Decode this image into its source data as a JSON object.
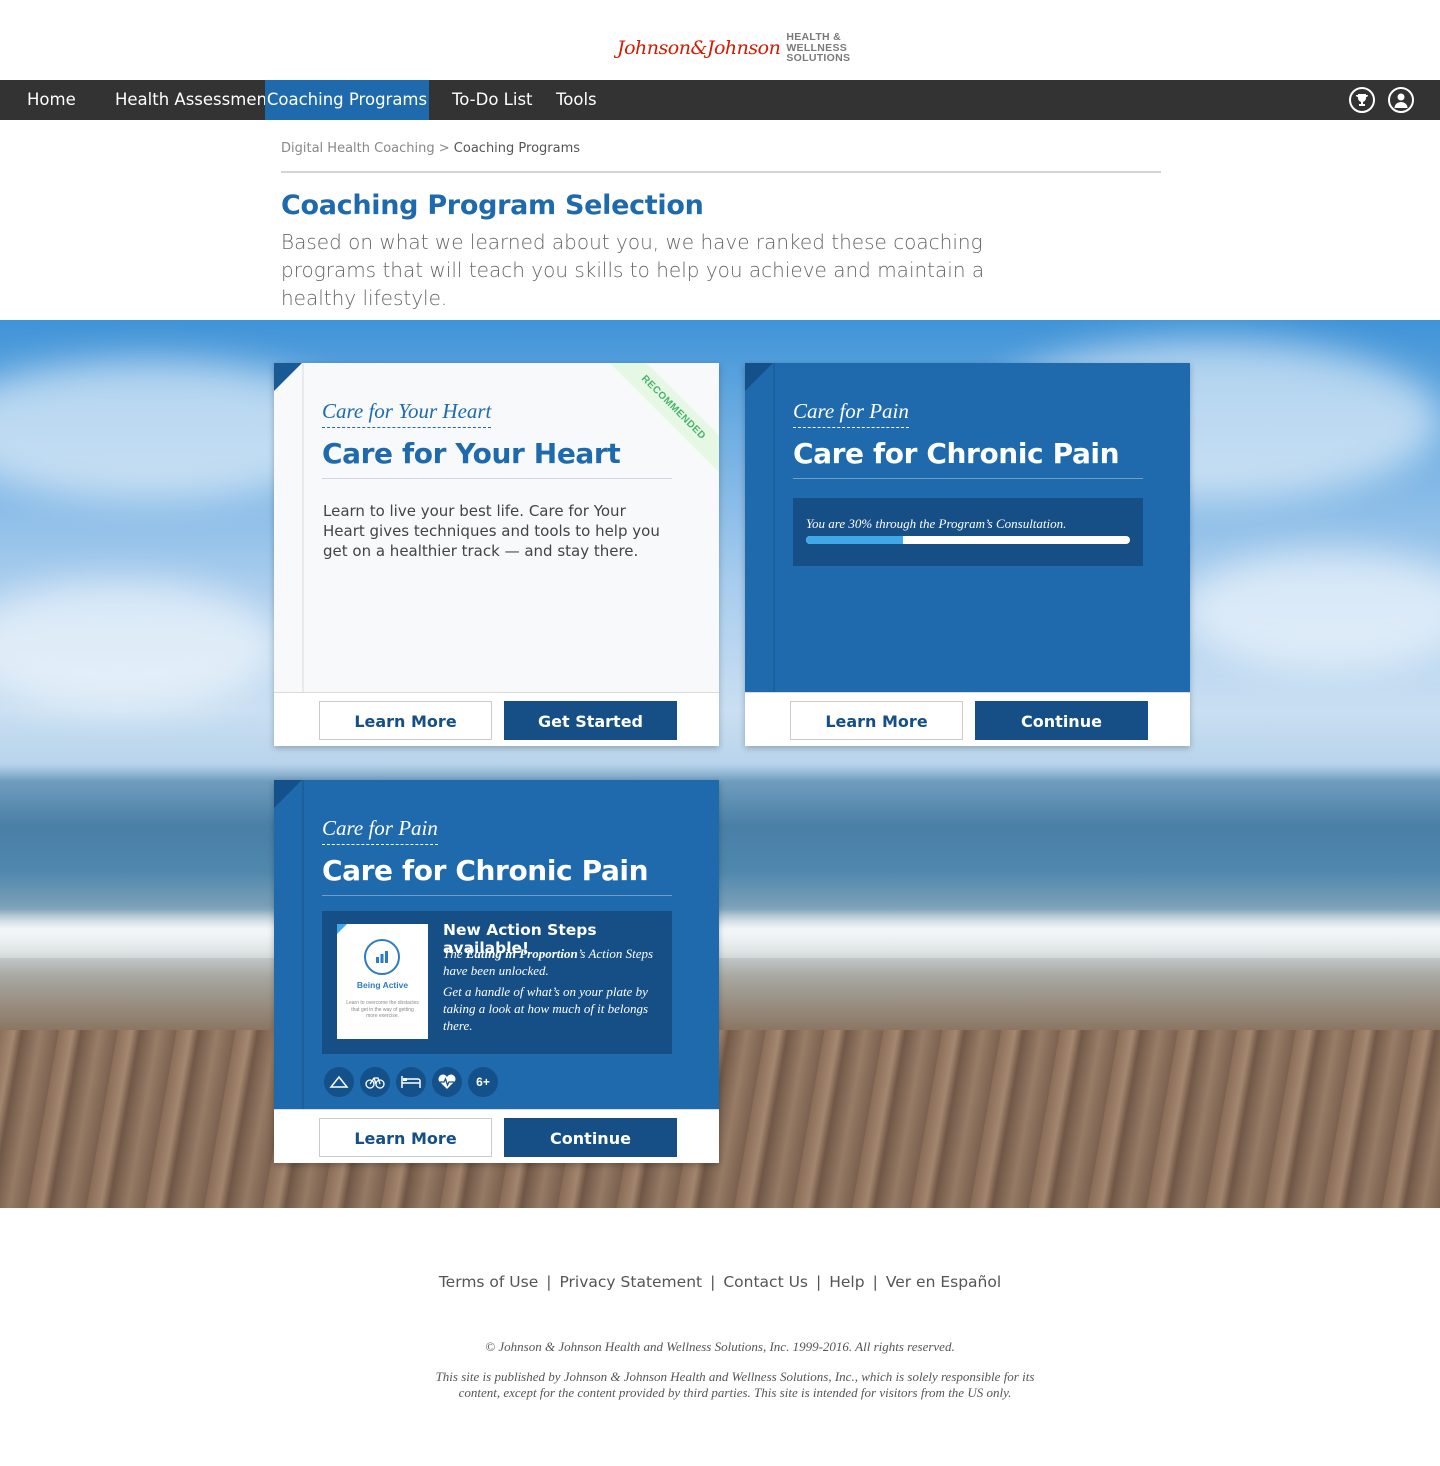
{
  "brand": {
    "logo_script": "Johnson&Johnson",
    "logo_lines": [
      "HEALTH &",
      "WELLNESS",
      "SOLUTIONS"
    ],
    "accent_color": "#1f6aad",
    "nav_color": "#333333",
    "button_color": "#154f86"
  },
  "nav": {
    "items": [
      {
        "label": "Home"
      },
      {
        "label": "Health Assessment"
      },
      {
        "label": "Coaching Programs",
        "active": true
      },
      {
        "label": "To-Do List"
      },
      {
        "label": "Tools"
      }
    ],
    "icons": [
      "trophy-icon",
      "user-profile-icon"
    ]
  },
  "breadcrumb": {
    "parent": "Digital Health Coaching",
    "separator": ">",
    "current": "Coaching Programs"
  },
  "page": {
    "title": "Coaching Program Selection",
    "subtitle": "Based on what we learned about you, we have ranked these coaching programs that will teach you skills to help you achieve and maintain a healthy lifestyle."
  },
  "cards": [
    {
      "eyebrow": "Care for Your Heart",
      "title": "Care for Your Heart",
      "ribbon": "RECOMMENDED",
      "description": "Learn to live your best life. Care for Your Heart gives techniques and tools to help you get on a healthier track — and stay there.",
      "secondary_button": "Learn More",
      "primary_button": "Get Started"
    },
    {
      "eyebrow": "Care for Pain",
      "title": "Care for Chronic Pain",
      "progress_text": "You are 30% through the Program’s Consultation.",
      "progress_fraction": 0.3,
      "secondary_button": "Learn More",
      "primary_button": "Continue"
    },
    {
      "eyebrow": "Care for Pain",
      "title": "Care for Chronic Pain",
      "thumb_title": "Being Active",
      "thumb_text": "Learn to overcome the obstacles that get in the way of getting more exercise.",
      "action_heading": "New Action Steps available!",
      "action_line1_pre": "The ",
      "action_line1_bold": "Eating in Proportion",
      "action_line1_post": "’s Action Steps have been unlocked.",
      "action_line2": "Get a handle of what’s on your plate by taking a look at how much of it belongs there.",
      "category_icons": [
        "hanger-icon",
        "bicycle-icon",
        "bed-icon",
        "heart-rate-icon"
      ],
      "more_count": "6+",
      "secondary_button": "Learn More",
      "primary_button": "Continue"
    }
  ],
  "footer": {
    "links": [
      "Terms of Use",
      "Privacy Statement",
      "Contact Us",
      "Help",
      "Ver en Español"
    ],
    "separator": "|",
    "copyright": "© Johnson & Johnson Health and Wellness Solutions, Inc. 1999-2016. All rights reserved.",
    "disclaimer": "This site is published by Johnson & Johnson Health and Wellness Solutions, Inc., which is solely responsible for its content, except for the content provided by third parties.  This site is intended for visitors from the US only."
  }
}
